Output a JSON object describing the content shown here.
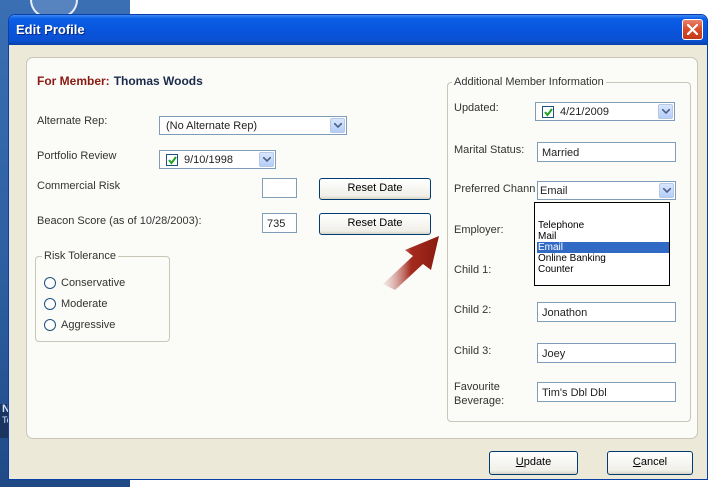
{
  "window": {
    "title": "Edit Profile"
  },
  "desktop": {
    "badge_line1": "N",
    "badge_line2": "Te"
  },
  "member": {
    "label": "For Member:",
    "name": "Thomas Woods"
  },
  "left": {
    "alternate_rep_label": "Alternate Rep:",
    "alternate_rep_value": "(No Alternate Rep)",
    "portfolio_review_label": "Portfolio Review",
    "portfolio_review_date": "9/10/1998",
    "commercial_risk_label": "Commercial Risk",
    "commercial_risk_value": "",
    "beacon_score_label": "Beacon Score (as of 10/28/2003):",
    "beacon_score_value": "735",
    "reset_date_label": "Reset Date",
    "risk_tolerance_label": "Risk Tolerance",
    "risk_options": [
      "Conservative",
      "Moderate",
      "Aggressive"
    ]
  },
  "right": {
    "group_label": "Additional Member Information",
    "updated_label": "Updated:",
    "updated_date": "4/21/2009",
    "marital_status_label": "Marital Status:",
    "marital_status_value": "Married",
    "preferred_channel_label": "Preferred Chann",
    "preferred_channel_value": "Email",
    "employer_label": "Employer:",
    "child1_label": "Child 1:",
    "child2_label": "Child 2:",
    "child2_value": "Jonathon",
    "child3_label": "Child 3:",
    "child3_value": "Joey",
    "beverage_label_1": "Favourite",
    "beverage_label_2": "Beverage:",
    "beverage_value": "Tim's Dbl Dbl"
  },
  "dropdown": {
    "options": [
      "",
      "Telephone",
      "Mail",
      "Email",
      "Online Banking",
      "Counter"
    ],
    "selected": "Email"
  },
  "footer": {
    "update_mnemonic": "U",
    "update_rest": "pdate",
    "cancel_mnemonic": "C",
    "cancel_rest": "ancel"
  },
  "colors": {
    "title_bar": "#0855dd",
    "member_label": "#8b1a12",
    "selection": "#316ac5",
    "arrow": "#a52a1e"
  }
}
